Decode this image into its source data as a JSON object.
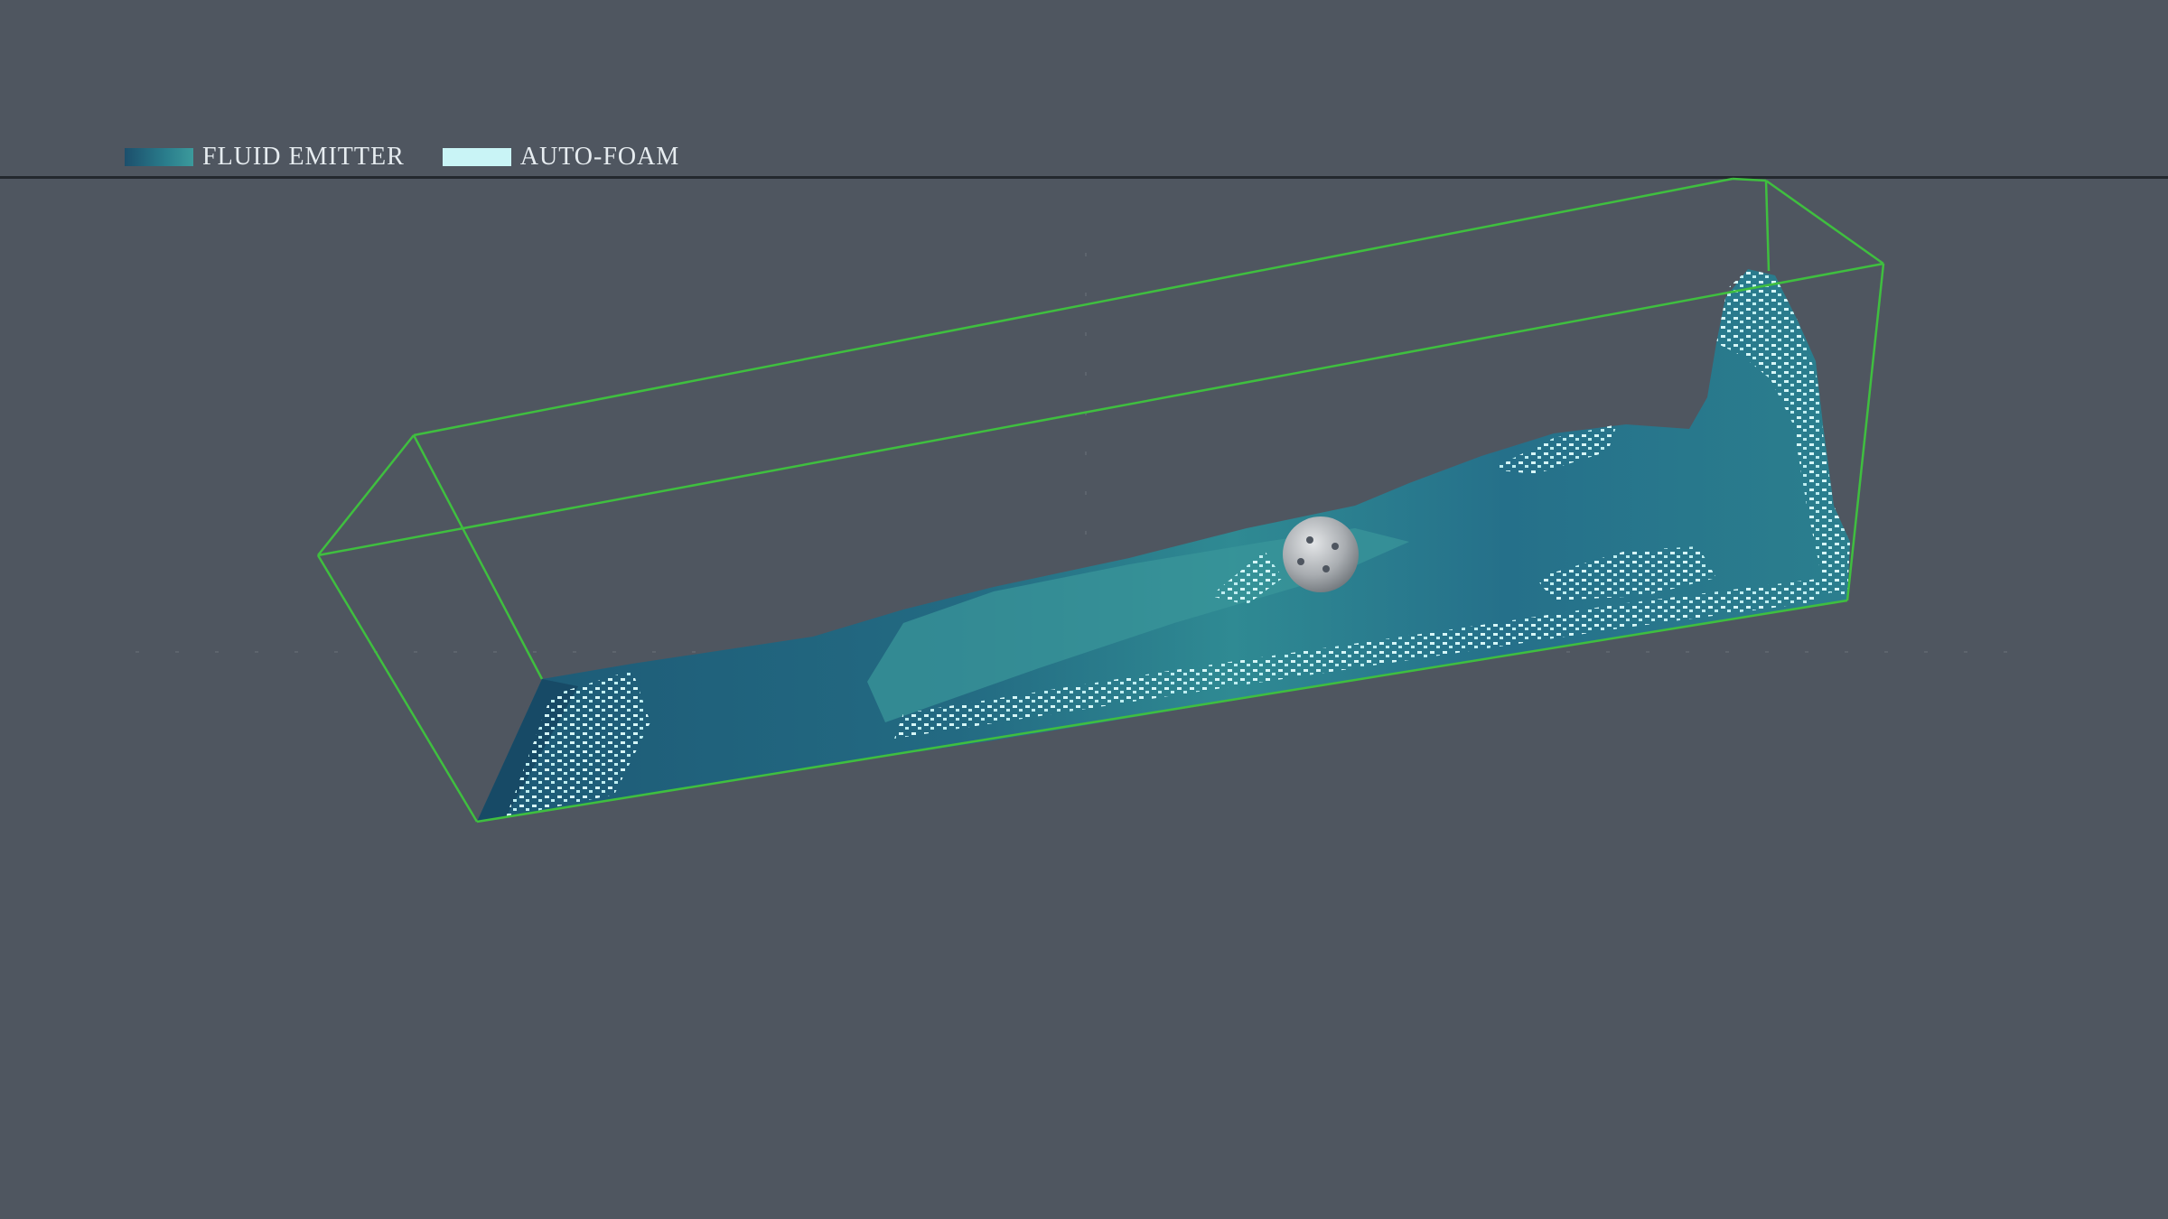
{
  "legend": {
    "items": [
      {
        "label": "FLUID EMITTER",
        "swatch": "fluid-gradient",
        "colors": [
          "#1c4f6c",
          "#3c9a9c"
        ]
      },
      {
        "label": "AUTO-FOAM",
        "swatch": "foam",
        "colors": [
          "#c9f4f6"
        ]
      }
    ]
  },
  "colors": {
    "background": "#4f5660",
    "divider": "#23282e",
    "domain_box": "#3fbf3f",
    "fluid_dark": "#1c4f6c",
    "fluid_mid": "#2a7d8c",
    "fluid_light": "#3c9a9c",
    "foam": "#c9f4f6",
    "collider": "#b8bcbf"
  }
}
